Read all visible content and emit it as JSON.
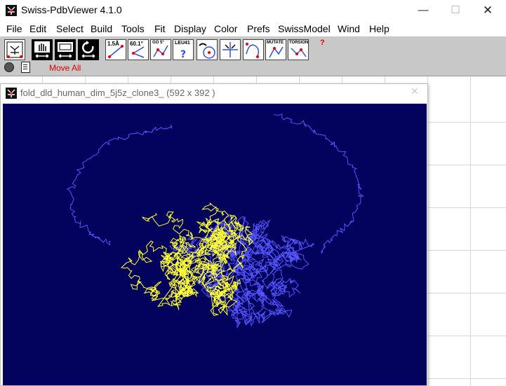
{
  "app": {
    "title": "Swiss-PdbViewer 4.1.0",
    "window_controls": {
      "minimize": "—",
      "maximize": "☐",
      "close": "✕"
    }
  },
  "menu": [
    "File",
    "Edit",
    "Select",
    "Build",
    "Tools",
    "Fit",
    "Display",
    "Color",
    "Prefs",
    "SwissModel",
    "Wind",
    "Help"
  ],
  "toolbar": {
    "buttons": [
      {
        "icon": "center-molecule-icon",
        "label": ""
      },
      {
        "icon": "hand-move-icon",
        "label": ""
      },
      {
        "icon": "zoom-screen-icon",
        "label": ""
      },
      {
        "icon": "rotate-icon",
        "label": ""
      },
      {
        "icon": "distance-icon",
        "label": "1.5Å"
      },
      {
        "icon": "angle-icon",
        "label": "60.1°"
      },
      {
        "icon": "dihedral-icon",
        "label": "GO 5°"
      },
      {
        "icon": "identify-icon",
        "label": "LEU41"
      },
      {
        "icon": "center-atom-icon",
        "label": ""
      },
      {
        "icon": "fit-icon",
        "label": ""
      },
      {
        "icon": "ramachandran-icon",
        "label": ""
      },
      {
        "icon": "mutate-icon",
        "label": "MUTATE"
      },
      {
        "icon": "torsion-icon",
        "label": "TORSION"
      }
    ],
    "help_label": "?",
    "move_all_label": "Move All",
    "colors": {
      "background": "#c8c8c8",
      "accent_red": "#e00000"
    }
  },
  "molecule_window": {
    "title": "fold_dld_human_dim_5j5z_clone3_  (592 x 392 )",
    "close_label": "✕",
    "colors": {
      "background": "#03035e",
      "chain_a": "#ffff33",
      "chain_b": "#5555ff"
    }
  }
}
